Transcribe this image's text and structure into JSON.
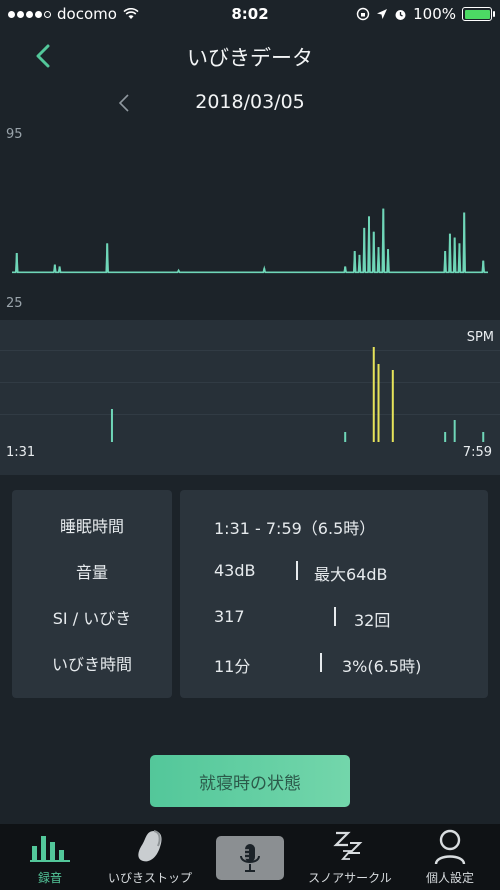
{
  "status_bar": {
    "carrier": "docomo",
    "time": "8:02",
    "battery_text": "100%",
    "battery_level": 1.0
  },
  "header": {
    "title": "いびきデータ",
    "back_icon": "chevron-left-icon"
  },
  "date_nav": {
    "date": "2018/03/05",
    "prev_icon": "chevron-left-icon"
  },
  "chart_data": [
    {
      "type": "line",
      "title": "",
      "ylim": [
        25,
        95
      ],
      "ytick_labels": [
        "95",
        "25"
      ],
      "color": "#6fd6b8",
      "baseline": 29,
      "spikes": [
        {
          "x": 1,
          "y": 39
        },
        {
          "x": 9,
          "y": 33
        },
        {
          "x": 10,
          "y": 32
        },
        {
          "x": 20,
          "y": 44
        },
        {
          "x": 35,
          "y": 30
        },
        {
          "x": 53,
          "y": 31
        },
        {
          "x": 70,
          "y": 32
        },
        {
          "x": 72,
          "y": 40
        },
        {
          "x": 73,
          "y": 38
        },
        {
          "x": 74,
          "y": 52
        },
        {
          "x": 75,
          "y": 58
        },
        {
          "x": 76,
          "y": 50
        },
        {
          "x": 77,
          "y": 42
        },
        {
          "x": 78,
          "y": 62
        },
        {
          "x": 79,
          "y": 41
        },
        {
          "x": 91,
          "y": 40
        },
        {
          "x": 92,
          "y": 49
        },
        {
          "x": 93,
          "y": 47
        },
        {
          "x": 94,
          "y": 44
        },
        {
          "x": 95,
          "y": 60
        },
        {
          "x": 99,
          "y": 35
        }
      ]
    },
    {
      "type": "bar",
      "label": "SPM",
      "x_start_label": "1:31",
      "x_end_label": "7:59",
      "bars": [
        {
          "x": 21,
          "h": 0.33,
          "color": "#6fd6b8"
        },
        {
          "x": 70,
          "h": 0.1,
          "color": "#6fd6b8"
        },
        {
          "x": 76,
          "h": 0.95,
          "color": "#e6e35a"
        },
        {
          "x": 77,
          "h": 0.78,
          "color": "#e6e35a"
        },
        {
          "x": 80,
          "h": 0.72,
          "color": "#e6e35a"
        },
        {
          "x": 91,
          "h": 0.1,
          "color": "#6fd6b8"
        },
        {
          "x": 93,
          "h": 0.22,
          "color": "#6fd6b8"
        },
        {
          "x": 99,
          "h": 0.1,
          "color": "#6fd6b8"
        }
      ]
    }
  ],
  "summary": {
    "rows": [
      {
        "label": "睡眠時間",
        "value1": "1:31 - 7:59（6.5時）",
        "value2": ""
      },
      {
        "label": "音量",
        "value1": "43dB",
        "value2": "最大64dB"
      },
      {
        "label": "SI / いびき",
        "value1": "317",
        "value2": "32回"
      },
      {
        "label": "いびき時間",
        "value1": "11分",
        "value2": "3%(6.5時)"
      }
    ]
  },
  "action_button": {
    "label": "就寝時の状態"
  },
  "tab_bar": {
    "tabs": [
      {
        "label": "録音",
        "icon": "bar-chart-icon",
        "active": true
      },
      {
        "label": "いびきストップ",
        "icon": "device-icon",
        "active": false
      },
      {
        "label": "",
        "icon": "microphone-icon",
        "active": false
      },
      {
        "label": "スノアサークル",
        "icon": "zzz-icon",
        "active": false
      },
      {
        "label": "個人設定",
        "icon": "person-icon",
        "active": false
      }
    ]
  },
  "colors": {
    "accent": "#53c79a",
    "line": "#6fd6b8",
    "highlight": "#e6e35a",
    "background": "#1c2329"
  }
}
